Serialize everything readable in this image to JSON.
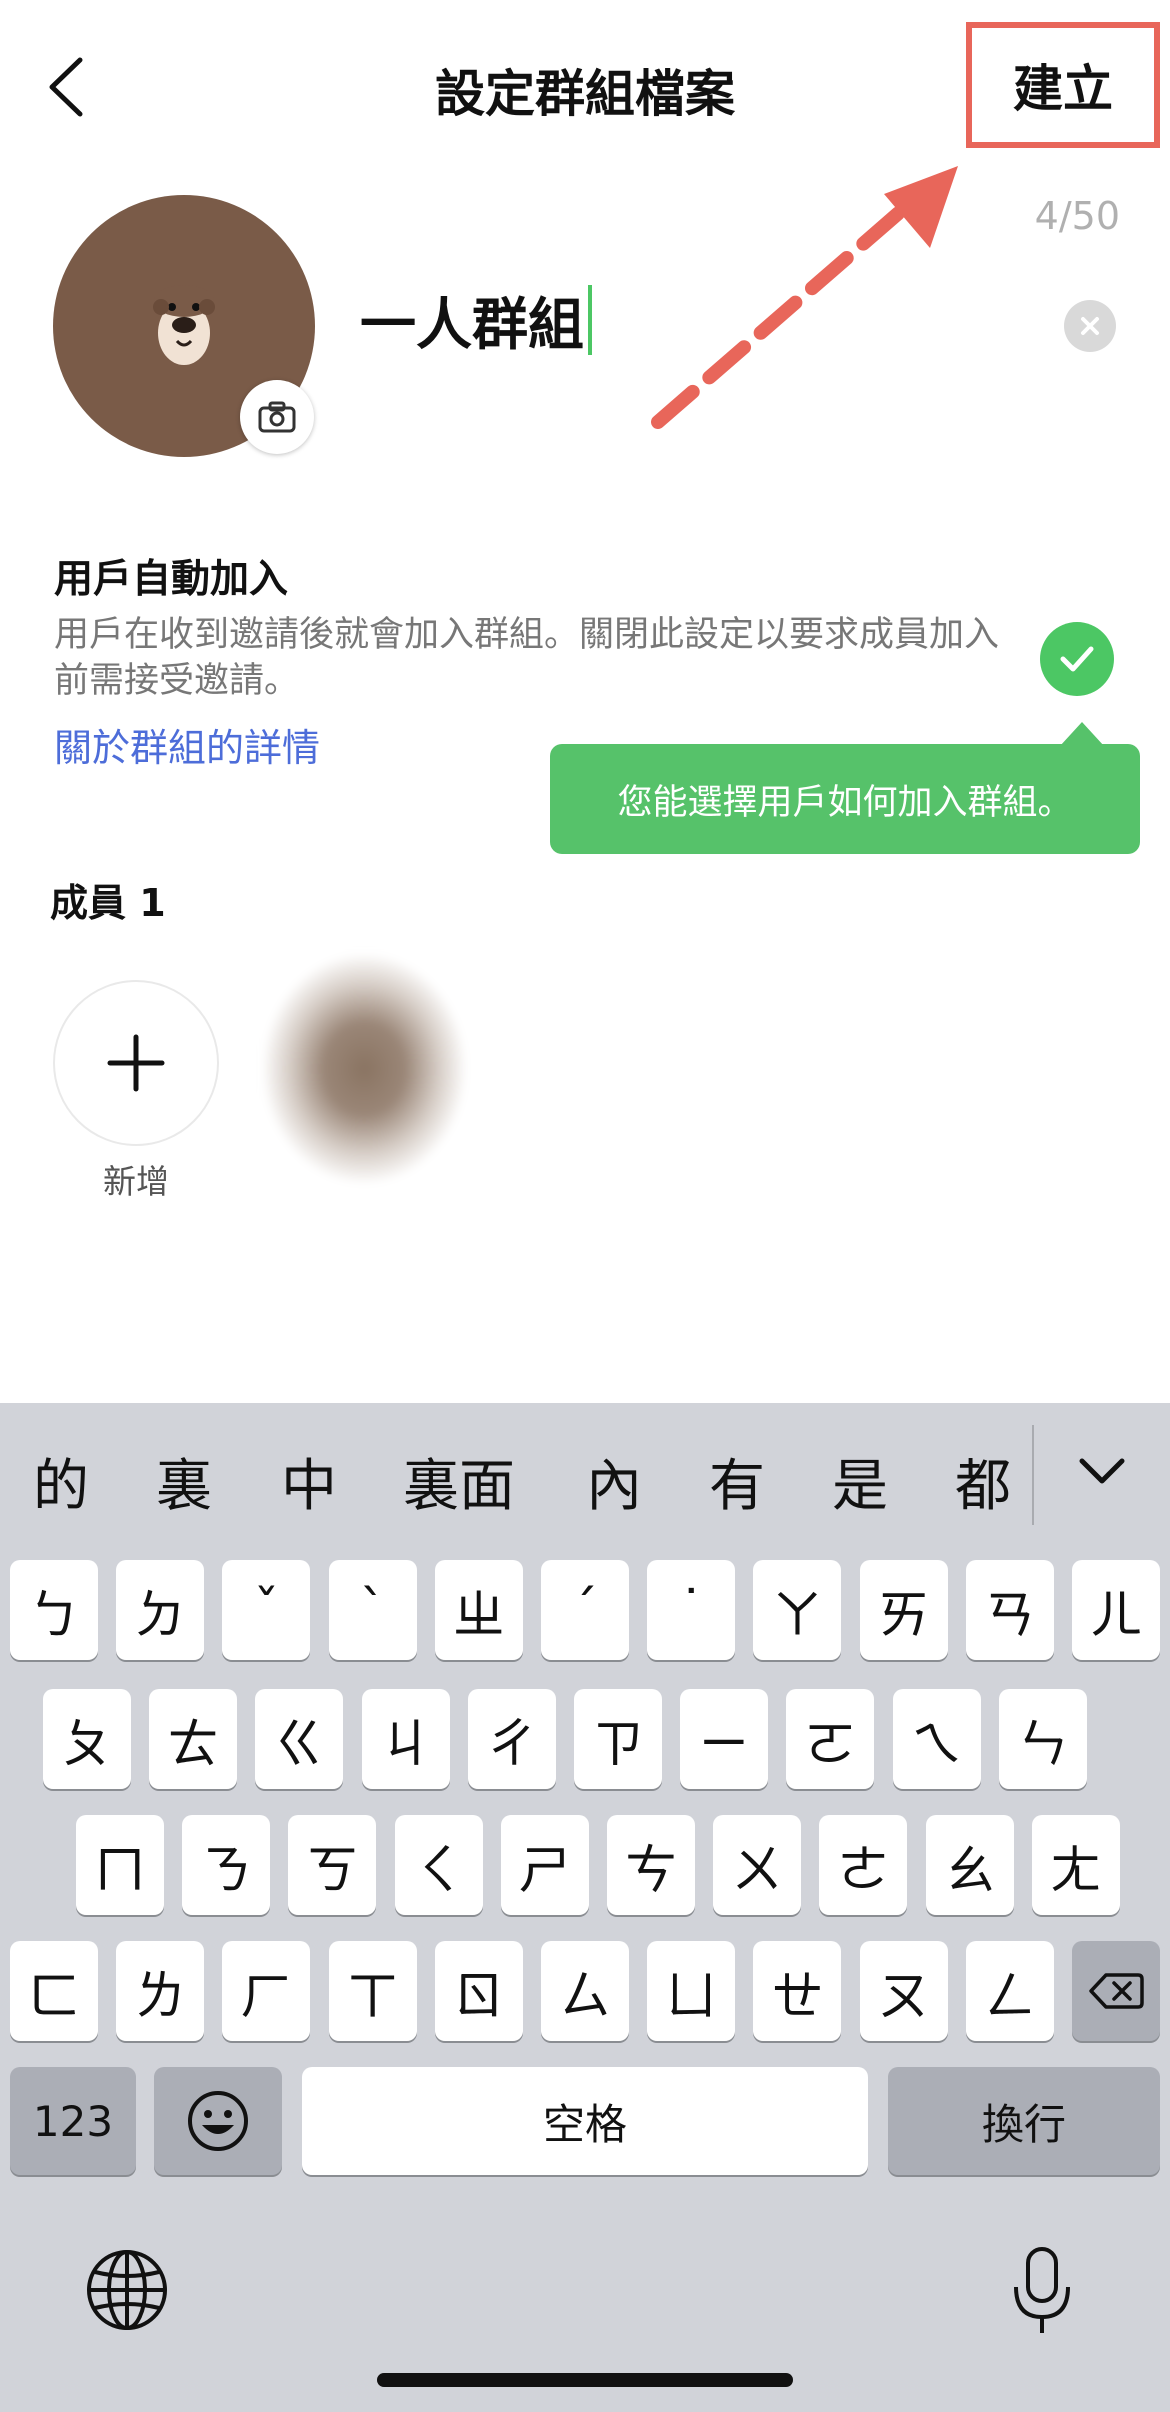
{
  "header": {
    "title": "設定群組檔案",
    "create_label": "建立"
  },
  "profile": {
    "group_name": "一人群組",
    "char_count": "4/50"
  },
  "auto_join": {
    "title": "用戶自動加入",
    "description": "用戶在收到邀請後就會加入群組。關閉此設定以要求成員加入前需接受邀請。",
    "link": "關於群組的詳情",
    "enabled": true,
    "tooltip": "您能選擇用戶如何加入群組。"
  },
  "members": {
    "title": "成員 1",
    "add_label": "新增"
  },
  "keyboard": {
    "candidates": [
      "的",
      "裏",
      "中",
      "裏面",
      "內",
      "有",
      "是",
      "都"
    ],
    "row1": [
      "ㄅ",
      "ㄉ",
      "ˇ",
      "ˋ",
      "ㄓ",
      "ˊ",
      "˙",
      "ㄚ",
      "ㄞ",
      "ㄢ",
      "ㄦ"
    ],
    "row2": [
      "ㄆ",
      "ㄊ",
      "ㄍ",
      "ㄐ",
      "ㄔ",
      "ㄗ",
      "ㄧ",
      "ㄛ",
      "ㄟ",
      "ㄣ"
    ],
    "row3": [
      "ㄇ",
      "ㄋ",
      "ㄎ",
      "ㄑ",
      "ㄕ",
      "ㄘ",
      "ㄨ",
      "ㄜ",
      "ㄠ",
      "ㄤ"
    ],
    "row4": [
      "ㄈ",
      "ㄌ",
      "ㄏ",
      "ㄒ",
      "ㄖ",
      "ㄙ",
      "ㄩ",
      "ㄝ",
      "ㄡ",
      "ㄥ"
    ],
    "numbers_label": "123",
    "space_label": "空格",
    "return_label": "換行"
  },
  "colors": {
    "accent_green": "#4cc764",
    "link_blue": "#4d6dd9",
    "highlight_red": "#e8665a"
  }
}
